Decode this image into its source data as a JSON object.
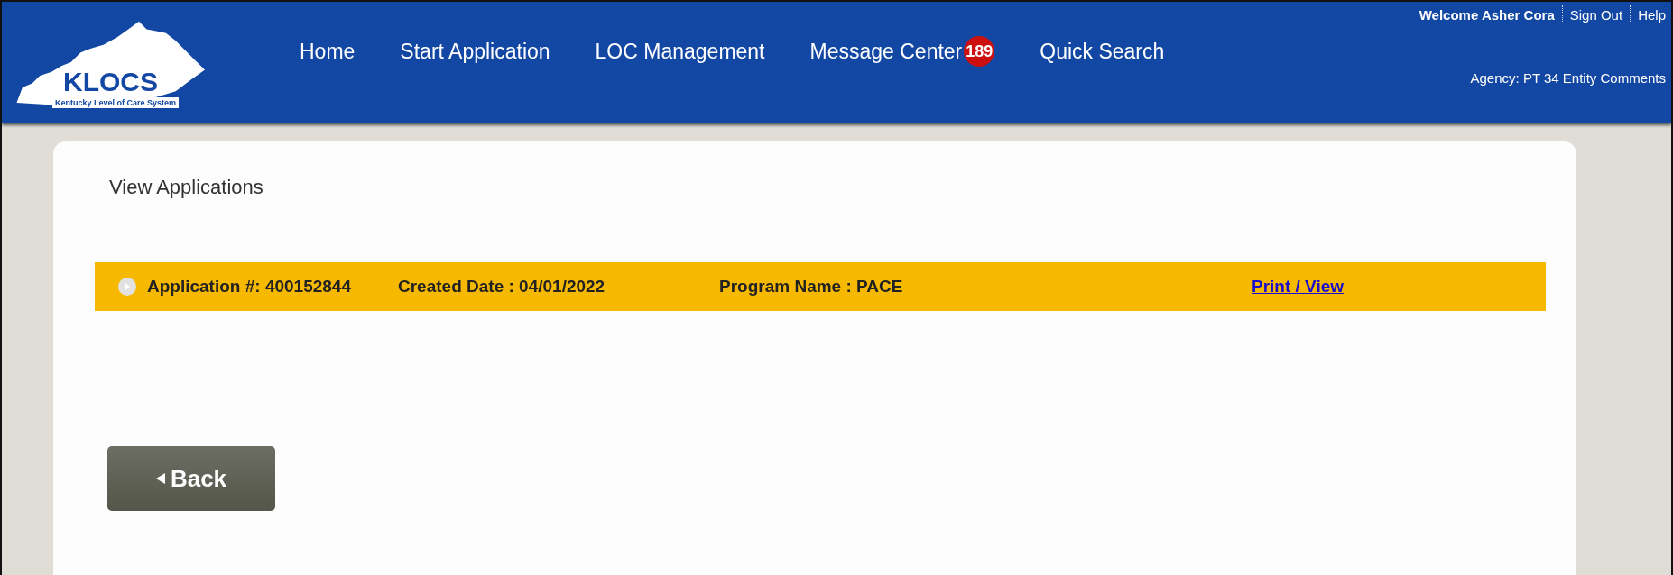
{
  "header": {
    "logo": {
      "text": "KLOCS",
      "subtitle": "Kentucky Level of Care System"
    },
    "nav": [
      {
        "label": "Home"
      },
      {
        "label": "Start Application"
      },
      {
        "label": "LOC Management"
      },
      {
        "label": "Message Center",
        "badge": "189"
      },
      {
        "label": "Quick Search"
      }
    ],
    "welcome": "Welcome Asher Cora",
    "links": [
      "Sign Out",
      "Help"
    ],
    "agency": "Agency: PT 34 Entity Comments"
  },
  "page": {
    "title": "View Applications",
    "applications": [
      {
        "expanded": false,
        "number": "Application #: 400152844",
        "created": "Created Date : 04/01/2022",
        "program": "Program Name : PACE",
        "link": "Print / View"
      }
    ],
    "back_button": "Back"
  }
}
